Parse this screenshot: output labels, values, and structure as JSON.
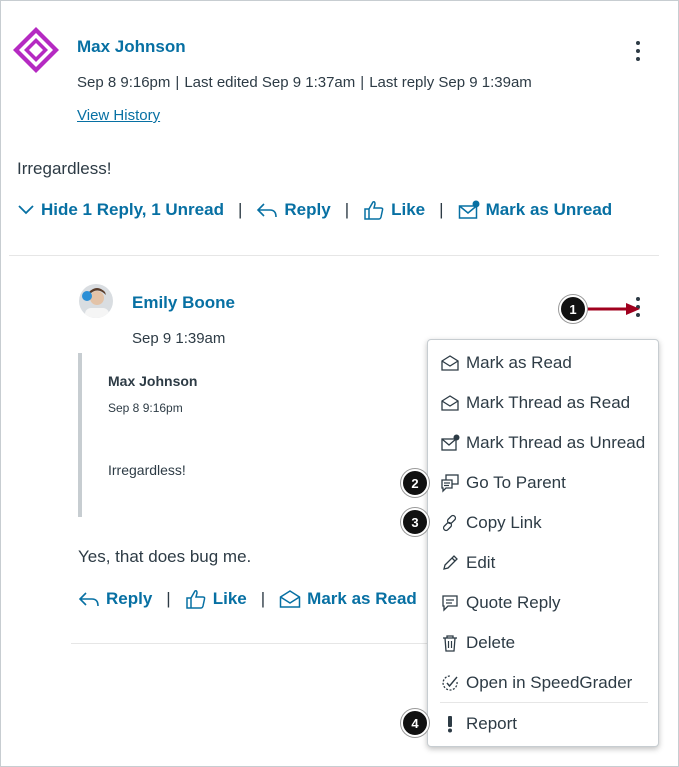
{
  "post": {
    "author": "Max Johnson",
    "posted": "Sep 8 9:16pm",
    "edited": "Last edited Sep 9 1:37am",
    "last_reply": "Last reply Sep 9 1:39am",
    "history_link": "View History",
    "body": "Irregardless!",
    "actions": {
      "hide_replies": "Hide 1 Reply, 1 Unread",
      "reply": "Reply",
      "like": "Like",
      "mark_unread": "Mark as Unread"
    }
  },
  "reply": {
    "author": "Emily Boone",
    "posted": "Sep 9 1:39am",
    "quote": {
      "author": "Max Johnson",
      "date": "Sep 8 9:16pm",
      "text": "Irregardless!"
    },
    "body": "Yes, that does bug me.",
    "actions": {
      "reply": "Reply",
      "like": "Like",
      "mark_read": "Mark as Read"
    }
  },
  "separator": "|",
  "menu": {
    "items": [
      {
        "label": "Mark as Read",
        "icon": "envelope-open-icon"
      },
      {
        "label": "Mark Thread as Read",
        "icon": "envelope-open-icon"
      },
      {
        "label": "Mark Thread as Unread",
        "icon": "envelope-unread-icon"
      },
      {
        "label": "Go To Parent",
        "icon": "go-to-parent-icon"
      },
      {
        "label": "Copy Link",
        "icon": "link-icon"
      },
      {
        "label": "Edit",
        "icon": "pencil-icon"
      },
      {
        "label": "Quote Reply",
        "icon": "quote-icon"
      },
      {
        "label": "Delete",
        "icon": "trash-icon"
      },
      {
        "label": "Open in SpeedGrader",
        "icon": "speedgrader-icon"
      },
      {
        "label": "Report",
        "icon": "exclamation-icon"
      }
    ]
  },
  "callouts": [
    "1",
    "2",
    "3",
    "4"
  ],
  "colors": {
    "link": "#0770a3",
    "text": "#2d3b45",
    "callout_arrow": "#a0001e",
    "avatar_purple": "#b52ac2"
  }
}
